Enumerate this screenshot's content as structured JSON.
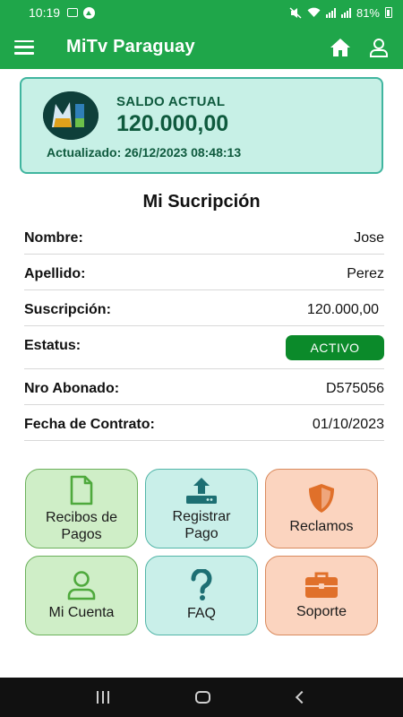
{
  "status_bar": {
    "time": "10:19",
    "battery": "81%"
  },
  "app": {
    "title": "MiTv Paraguay"
  },
  "balance": {
    "label": "SALDO ACTUAL",
    "amount": "120.000,00",
    "updated": "Actualizado: 26/12/2023 08:48:13"
  },
  "subscription": {
    "title": "Mi Sucripción",
    "rows": [
      {
        "label": "Nombre:",
        "value": "Jose"
      },
      {
        "label": "Apellido:",
        "value": "Perez"
      },
      {
        "label": "Suscripción:",
        "value": "120.000,00"
      },
      {
        "label": "Estatus:",
        "value": "ACTIVO"
      },
      {
        "label": "Nro Abonado:",
        "value": "D575056"
      },
      {
        "label": "Fecha de Contrato:",
        "value": "01/10/2023"
      }
    ]
  },
  "tiles": [
    {
      "label": "Recibos de Pagos",
      "icon": "document-icon"
    },
    {
      "label": "Registrar Pago",
      "icon": "upload-icon"
    },
    {
      "label": "Reclamos",
      "icon": "shield-icon"
    },
    {
      "label": "Mi Cuenta",
      "icon": "user-icon"
    },
    {
      "label": "FAQ",
      "icon": "question-icon"
    },
    {
      "label": "Soporte",
      "icon": "briefcase-icon"
    }
  ],
  "colors": {
    "primary": "#1fa64a",
    "card_bg": "#c7f0e6",
    "active": "#0b8a2a",
    "tile_green": "#cfeec7",
    "tile_teal": "#c9efe9",
    "tile_orange": "#fbd4bf"
  }
}
